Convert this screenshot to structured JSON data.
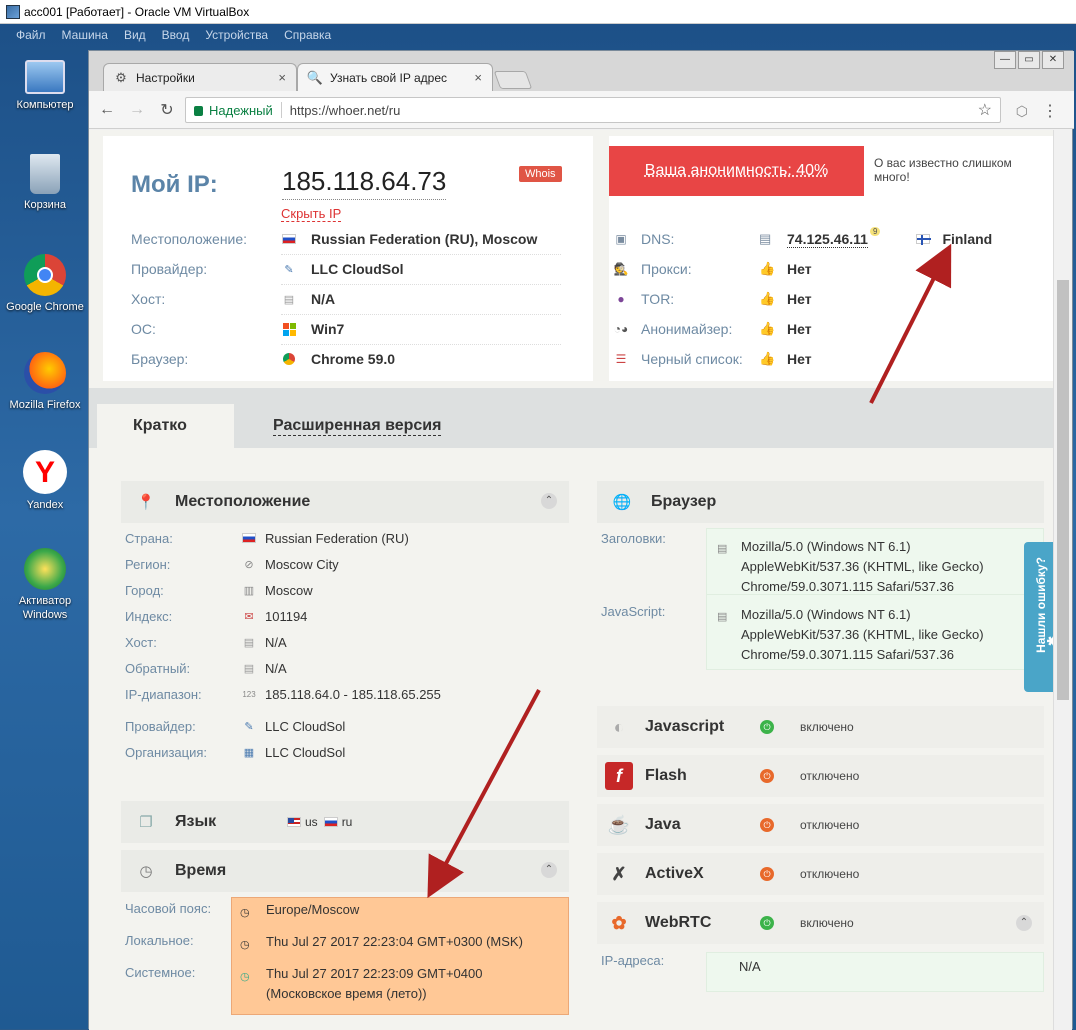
{
  "window": {
    "title": "acc001 [Работает] - Oracle VM VirtualBox"
  },
  "vbox_menu": [
    "Файл",
    "Машина",
    "Вид",
    "Ввод",
    "Устройства",
    "Справка"
  ],
  "desktop_icons": [
    {
      "label": "Компьютер",
      "icon": "computer-icon"
    },
    {
      "label": "Корзина",
      "icon": "recycle-bin-icon"
    },
    {
      "label": "Google Chrome",
      "icon": "chrome-icon"
    },
    {
      "label": "Mozilla Firefox",
      "icon": "firefox-icon"
    },
    {
      "label": "Yandex",
      "icon": "yandex-icon"
    },
    {
      "label": "Активатор Windows",
      "icon": "activator-icon"
    }
  ],
  "browser": {
    "tabs": [
      {
        "label": "Настройки"
      },
      {
        "label": "Узнать свой IP адрес"
      }
    ],
    "secure_label": "Надежный",
    "url": "https://whoer.net/ru"
  },
  "header": {
    "myip_label": "Мой IP:",
    "ip": "185.118.64.73",
    "hide_ip": "Скрыть IP",
    "whois": "Whois",
    "rows": [
      {
        "label": "Местоположение:",
        "value": "Russian Federation (RU), Moscow"
      },
      {
        "label": "Провайдер:",
        "value": "LLC CloudSol"
      },
      {
        "label": "Хост:",
        "value": "N/A"
      },
      {
        "label": "ОС:",
        "value": "Win7"
      },
      {
        "label": "Браузер:",
        "value": "Chrome 59.0"
      }
    ]
  },
  "anonymity": {
    "badge": "Ваша анонимность: 40%",
    "note": "О вас известно слишком много!",
    "rows": [
      {
        "label": "DNS:",
        "value": "74.125.46.11",
        "count": "9",
        "country": "Finland"
      },
      {
        "label": "Прокси:",
        "value": "Нет"
      },
      {
        "label": "TOR:",
        "value": "Нет"
      },
      {
        "label": "Анонимайзер:",
        "value": "Нет"
      },
      {
        "label": "Черный список:",
        "value": "Нет"
      }
    ]
  },
  "view_tabs": {
    "short": "Кратко",
    "extended": "Расширенная версия"
  },
  "location": {
    "title": "Местоположение",
    "rows": [
      {
        "label": "Страна:",
        "value": "Russian Federation (RU)"
      },
      {
        "label": "Регион:",
        "value": "Moscow City"
      },
      {
        "label": "Город:",
        "value": "Moscow"
      },
      {
        "label": "Индекс:",
        "value": "101194"
      },
      {
        "label": "Хост:",
        "value": "N/A"
      },
      {
        "label": "Обратный:",
        "value": "N/A"
      },
      {
        "label": "IP-диапазон:",
        "value": "185.118.64.0 - 185.118.65.255"
      },
      {
        "label": "Провайдер:",
        "value": "LLC CloudSol"
      },
      {
        "label": "Организация:",
        "value": "LLC CloudSol"
      }
    ]
  },
  "language": {
    "title": "Язык",
    "langs": [
      "us",
      "ru"
    ]
  },
  "time": {
    "title": "Время",
    "labels": [
      "Часовой пояс:",
      "Локальное:",
      "Системное:"
    ],
    "timezone": "Europe/Moscow",
    "local": "Thu Jul 27 2017 22:23:04 GMT+0300 (MSK)",
    "system_line1": "Thu Jul 27 2017 22:23:09 GMT+0400",
    "system_line2": "(Московское время (лето))"
  },
  "browser_section": {
    "title": "Браузер",
    "headers_label": "Заголовки:",
    "headers_lines": [
      "Mozilla/5.0 (Windows NT 6.1)",
      "AppleWebKit/537.36 (KHTML, like Gecko)",
      "Chrome/59.0.3071.115 Safari/537.36"
    ],
    "js_label": "JavaScript:",
    "js_lines": [
      "Mozilla/5.0 (Windows NT 6.1)",
      "AppleWebKit/537.36 (KHTML, like Gecko)",
      "Chrome/59.0.3071.115 Safari/537.36"
    ]
  },
  "plugins": [
    {
      "name": "Javascript",
      "status": "включено",
      "on": true
    },
    {
      "name": "Flash",
      "status": "отключено",
      "on": false
    },
    {
      "name": "Java",
      "status": "отключено",
      "on": false
    },
    {
      "name": "ActiveX",
      "status": "отключено",
      "on": false
    },
    {
      "name": "WebRTC",
      "status": "включено",
      "on": true
    }
  ],
  "webrtc": {
    "label": "IP-адреса:",
    "value": "N/A"
  },
  "feedback": "Нашли ошибку?",
  "colors": {
    "accent_red": "#e84545",
    "link_blue": "#6e8aa3",
    "on_green": "#3cb34a",
    "off_orange": "#e8692b",
    "time_bg": "#ffc896"
  }
}
